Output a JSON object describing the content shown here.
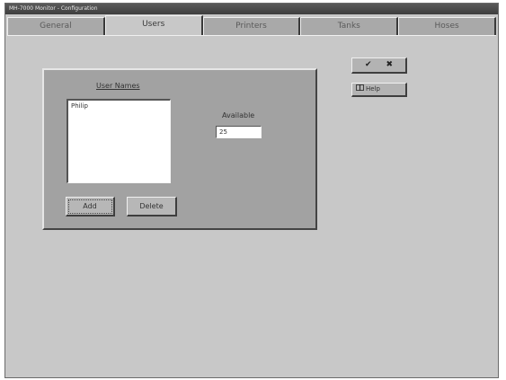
{
  "window": {
    "title": "MH-7000 Monitor - Configuration"
  },
  "tabs": [
    {
      "label": "General",
      "active": false
    },
    {
      "label": "Users",
      "active": true
    },
    {
      "label": "Printers",
      "active": false
    },
    {
      "label": "Tanks",
      "active": false
    },
    {
      "label": "Hoses",
      "active": false
    }
  ],
  "users_panel": {
    "list_label": "User Names",
    "users": [
      "Philip"
    ],
    "available_label": "Available",
    "available_value": "25",
    "add_label": "Add",
    "delete_label": "Delete"
  },
  "actions": {
    "ok_icon": "checkmark-icon",
    "cancel_icon": "x-icon",
    "help_label": "Help",
    "help_icon": "help-book-icon"
  },
  "colors": {
    "window_bg": "#c8c8c8",
    "panel_bg": "#a2a2a2",
    "titlebar": "#4a4a4a"
  }
}
